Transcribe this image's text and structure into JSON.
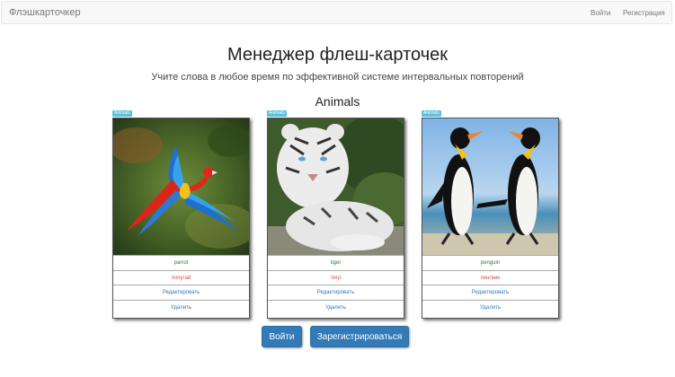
{
  "navbar": {
    "brand": "Флэшкарточкер",
    "login": "Войти",
    "register": "Регистрация"
  },
  "header": {
    "title": "Менеджер флеш-карточек",
    "subtitle": "Учите слова в любое время по эффективной системе интервальных повторений"
  },
  "section": {
    "title": "Animals"
  },
  "cards": [
    {
      "tag": "Animals",
      "word": "parrot",
      "translation": "попугай",
      "edit_label": "Редактировать",
      "delete_label": "Удалить"
    },
    {
      "tag": "Animals",
      "word": "tiger",
      "translation": "тигр",
      "edit_label": "Редактировать",
      "delete_label": "Удалить"
    },
    {
      "tag": "Animals",
      "word": "penguin",
      "translation": "пингвин",
      "edit_label": "Редактировать",
      "delete_label": "Удалить"
    }
  ],
  "actions": {
    "login": "Войти",
    "register": "Зарегистрироваться"
  },
  "colors": {
    "primary": "#337ab7",
    "tag": "#5bc0de",
    "word": "#2e7d32",
    "translation": "#d9534f"
  }
}
